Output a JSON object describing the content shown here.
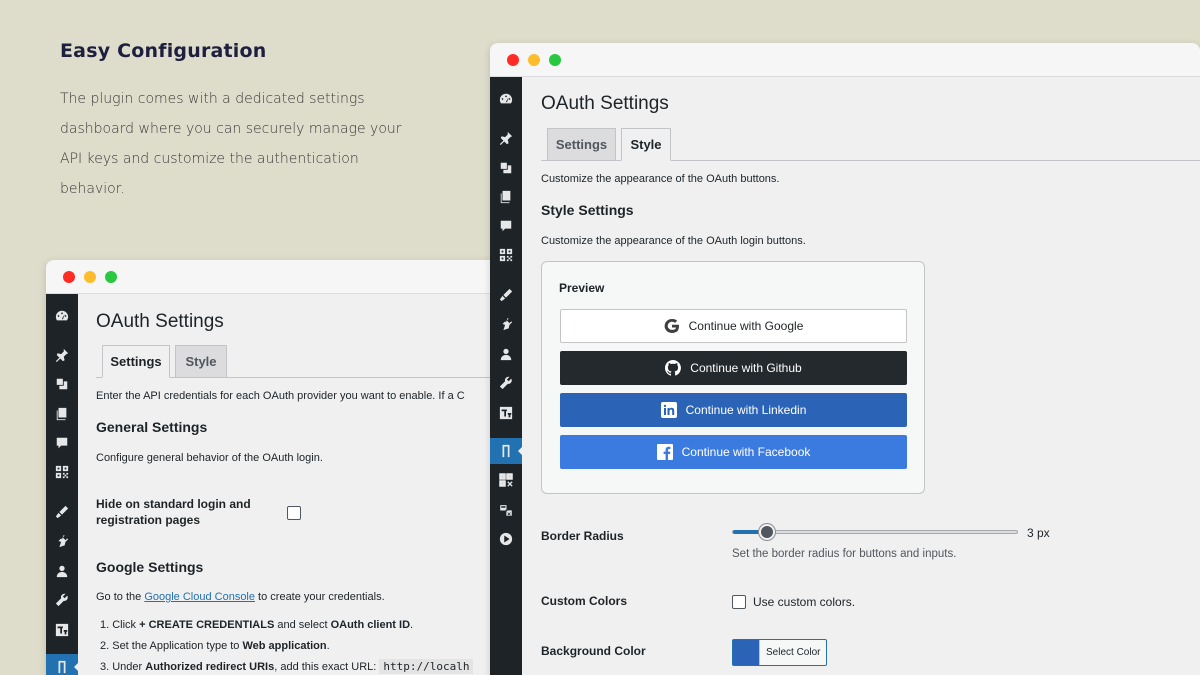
{
  "promo": {
    "title": "Easy Configuration",
    "body": "The plugin comes with a dedicated settings dashboard where you can securely manage your API keys and customize the authentication behavior."
  },
  "back_window": {
    "page_title": "OAuth Settings",
    "tabs": [
      "Settings",
      "Style"
    ],
    "active_tab": "Settings",
    "intro": "Enter the API credentials for each OAuth provider you want to enable. If a C",
    "general": {
      "heading": "General Settings",
      "desc": "Configure general behavior of the OAuth login.",
      "hide_label_line1": "Hide on standard login and",
      "hide_label_line2": "registration pages",
      "hide_checked": false
    },
    "google": {
      "heading": "Google Settings",
      "desc_before": "Go to the ",
      "desc_link": "Google Cloud Console",
      "desc_after": " to create your credentials.",
      "step1_a": "1. Click ",
      "step1_b": "+ CREATE CREDENTIALS",
      "step1_c": " and select ",
      "step1_d": "OAuth client ID",
      "step1_e": ".",
      "step2_a": "2. Set the Application type to ",
      "step2_b": "Web application",
      "step2_c": ".",
      "step3_a": "3. Under ",
      "step3_b": "Authorized redirect URIs",
      "step3_c": ", add this exact URL: ",
      "step3_code": "http://localh"
    }
  },
  "front_window": {
    "page_title": "OAuth Settings",
    "tabs": [
      "Settings",
      "Style"
    ],
    "active_tab": "Style",
    "intro": "Customize the appearance of the OAuth buttons.",
    "style": {
      "heading": "Style Settings",
      "desc": "Customize the appearance of the OAuth login buttons."
    },
    "preview": {
      "label": "Preview",
      "buttons": [
        {
          "provider": "google",
          "label": "Continue with Google"
        },
        {
          "provider": "github",
          "label": "Continue with Github"
        },
        {
          "provider": "linkedin",
          "label": "Continue with Linkedin"
        },
        {
          "provider": "facebook",
          "label": "Continue with Facebook"
        }
      ]
    },
    "border_radius": {
      "label": "Border Radius",
      "value_text": "3 px",
      "value": 3,
      "fraction": 0.12,
      "help": "Set the border radius for buttons and inputs."
    },
    "custom_colors": {
      "label": "Custom Colors",
      "checkbox_label": "Use custom colors.",
      "checked": false
    },
    "background_color": {
      "label": "Background Color",
      "button_label": "Select Color",
      "color": "#2b64b7"
    }
  },
  "colors": {
    "accent": "#2271b1",
    "sidebar": "#1d2327",
    "github": "#24292e",
    "linkedin": "#2b64b7",
    "facebook": "#3b7be0"
  }
}
